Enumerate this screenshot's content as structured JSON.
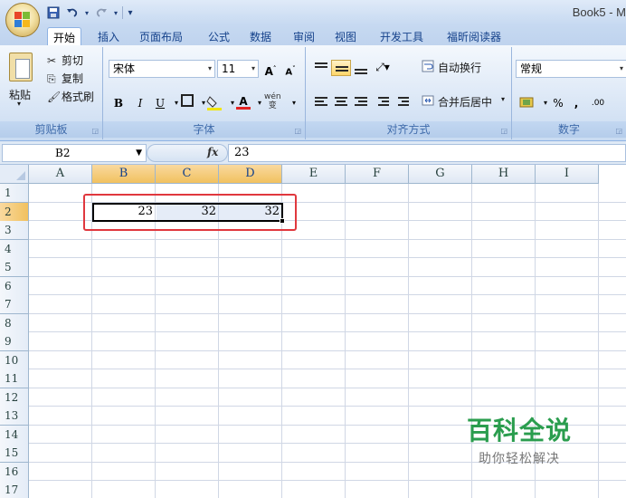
{
  "window": {
    "title": "Book5 - M"
  },
  "qat": {
    "save_icon": "save-icon",
    "undo_icon": "undo-icon",
    "redo_icon": "redo-icon"
  },
  "tabs": [
    {
      "label": "开始",
      "active": true
    },
    {
      "label": "插入"
    },
    {
      "label": "页面布局"
    },
    {
      "label": "公式"
    },
    {
      "label": "数据"
    },
    {
      "label": "审阅"
    },
    {
      "label": "视图"
    },
    {
      "label": "开发工具"
    },
    {
      "label": "福昕阅读器"
    }
  ],
  "ribbon": {
    "clipboard": {
      "paste": "粘贴",
      "cut": "剪切",
      "copy": "复制",
      "format_painter": "格式刷",
      "group_label": "剪贴板"
    },
    "font": {
      "font_name": "宋体",
      "font_size": "11",
      "bold": "B",
      "italic": "I",
      "underline": "U",
      "wen": "wén\n变",
      "group_label": "字体"
    },
    "alignment": {
      "wrap_text": "自动换行",
      "merge_center": "合并后居中",
      "group_label": "对齐方式"
    },
    "number": {
      "format": "常规",
      "percent": "%",
      "comma": ",",
      "inc_decimal": ".00",
      "group_label": "数字"
    }
  },
  "formula_bar": {
    "name_box": "B2",
    "fx": "fx",
    "value": "23"
  },
  "columns": [
    "A",
    "B",
    "C",
    "D",
    "E",
    "F",
    "G",
    "H",
    "I"
  ],
  "rows": [
    "1",
    "2",
    "3",
    "4",
    "5",
    "6",
    "7",
    "8",
    "9",
    "10",
    "11",
    "12",
    "13",
    "14",
    "15",
    "16",
    "17"
  ],
  "cells": {
    "B2": "23",
    "C2": "32",
    "D2": "32"
  },
  "watermark": {
    "title": "百科全说",
    "subtitle": "助你轻松解决"
  },
  "colors": {
    "highlight": "#e0383e",
    "selected_header": "#f1c15f",
    "watermark": "#2a9d4e"
  }
}
